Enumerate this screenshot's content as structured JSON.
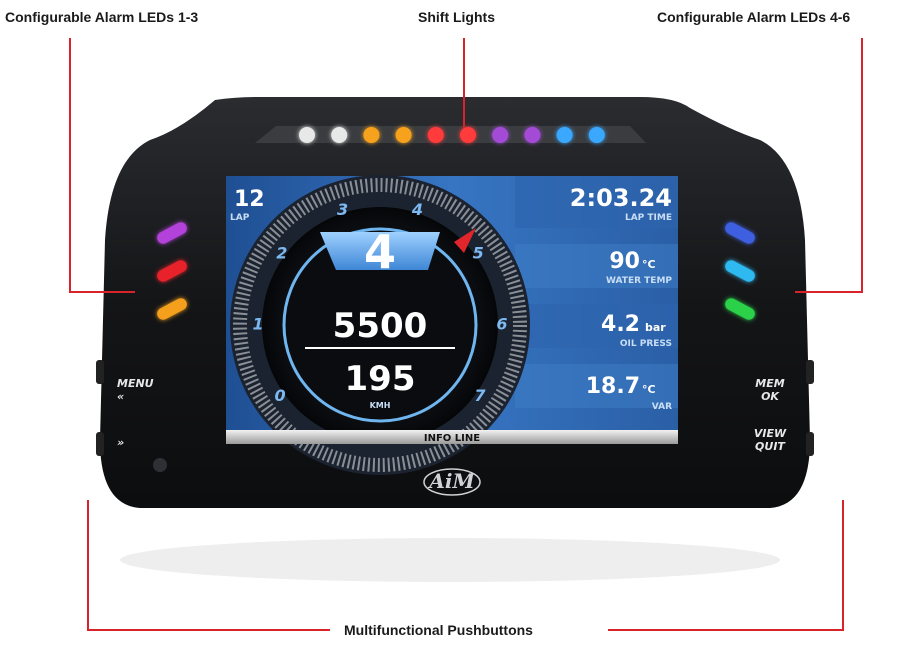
{
  "callouts": {
    "alarm_left": "Configurable Alarm LEDs 1-3",
    "shift_lights": "Shift Lights",
    "alarm_right": "Configurable Alarm LEDs 4-6",
    "pushbuttons": "Multifunctional Pushbuttons"
  },
  "colors": {
    "leader_line": "#d8232a",
    "shell": "#151618",
    "screen_bg": "#2f63a8"
  },
  "shift_lights": [
    "#e8e8e8",
    "#e8e8e8",
    "#f7a21b",
    "#f7a21b",
    "#ff3b3b",
    "#ff3b3b",
    "#a34bd6",
    "#a34bd6",
    "#3aa8ff",
    "#3aa8ff"
  ],
  "alarm_leds_left": [
    "#b243d9",
    "#e8232a",
    "#f5a01b"
  ],
  "alarm_leds_right": [
    "#3c5fe0",
    "#2fb9f0",
    "#2bd14a"
  ],
  "screen": {
    "lap_value": "12",
    "lap_label": "LAP",
    "gear": "4",
    "rpm": "5500",
    "speed": "195",
    "speed_unit": "KMH",
    "info_line": "INFO LINE",
    "tach_marks": [
      "0",
      "1",
      "2",
      "3",
      "4",
      "5",
      "6",
      "7"
    ],
    "fields": [
      {
        "value": "2:03.24",
        "unit": "",
        "label": "LAP TIME"
      },
      {
        "value": "90",
        "unit": "°C",
        "label": "WATER TEMP"
      },
      {
        "value": "4.2",
        "unit": "bar",
        "label": "OIL PRESS"
      },
      {
        "value": "18.7",
        "unit": "°C",
        "label": "VAR"
      }
    ]
  },
  "buttons": {
    "menu": "MENU",
    "menu_arrows": "«",
    "next_arrows": "»",
    "mem": "MEM",
    "ok": "OK",
    "view": "VIEW",
    "quit": "QUIT"
  },
  "brand": "AiM"
}
